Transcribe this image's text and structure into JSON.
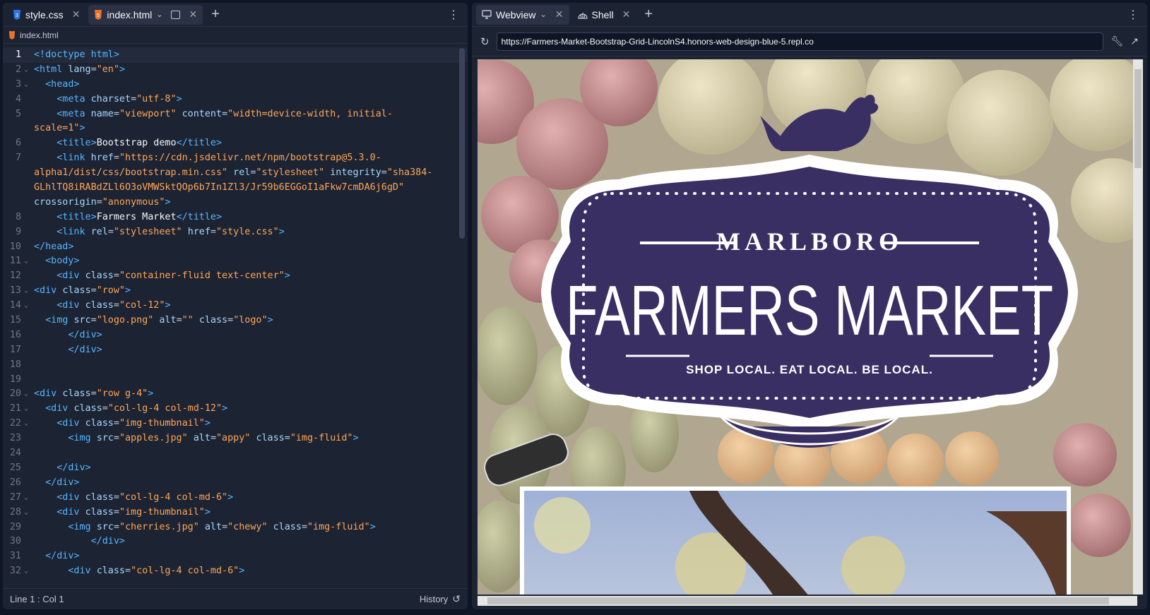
{
  "editor_tabs": [
    {
      "label": "style.css",
      "icon": "css-file-icon"
    },
    {
      "label": "index.html",
      "icon": "html-file-icon"
    }
  ],
  "breadcrumb": "index.html",
  "code_lines": [
    {
      "n": "1",
      "fold": "",
      "html": "<span class='t'>&lt;!doctype html&gt;</span>"
    },
    {
      "n": "2",
      "fold": "⌄",
      "html": "<span class='t'>&lt;html</span> <span class='a'>lang</span>=<span class='s'>\"en\"</span><span class='t'>&gt;</span>"
    },
    {
      "n": "3",
      "fold": "⌄",
      "html": "  <span class='t'>&lt;head&gt;</span>"
    },
    {
      "n": "4",
      "fold": "",
      "html": "    <span class='t'>&lt;meta</span> <span class='a'>charset</span>=<span class='s'>\"utf-8\"</span><span class='t'>&gt;</span>"
    },
    {
      "n": "5",
      "fold": "",
      "html": "    <span class='t'>&lt;meta</span> <span class='a'>name</span>=<span class='s'>\"viewport\"</span> <span class='a'>content</span>=<span class='s'>\"width=device-width, initial-</span>"
    },
    {
      "n": "",
      "fold": "",
      "html": "<span class='s'>scale=1\"</span><span class='t'>&gt;</span>"
    },
    {
      "n": "6",
      "fold": "",
      "html": "    <span class='t'>&lt;title&gt;</span><span class='w'>Bootstrap demo</span><span class='t'>&lt;/title&gt;</span>"
    },
    {
      "n": "7",
      "fold": "",
      "html": "    <span class='t'>&lt;link</span> <span class='a'>href</span>=<span class='s'>\"https://cdn.jsdelivr.net/npm/bootstrap@5.3.0-</span>"
    },
    {
      "n": "",
      "fold": "",
      "html": "<span class='s'>alpha1/dist/css/bootstrap.min.css\"</span> <span class='a'>rel</span>=<span class='s'>\"stylesheet\"</span> <span class='a'>integrity</span>=<span class='s'>\"sha384-</span>"
    },
    {
      "n": "",
      "fold": "",
      "html": "<span class='s'>GLhlTQ8iRABdZLl6O3oVMWSktQOp6b7In1Zl3/Jr59b6EGGoI1aFkw7cmDA6j6gD\"</span>"
    },
    {
      "n": "",
      "fold": "",
      "html": "<span class='a'>crossorigin</span>=<span class='s'>\"anonymous\"</span><span class='t'>&gt;</span>"
    },
    {
      "n": "8",
      "fold": "",
      "html": "    <span class='t'>&lt;title&gt;</span><span class='w'>Farmers Market</span><span class='t'>&lt;/title&gt;</span>"
    },
    {
      "n": "9",
      "fold": "",
      "html": "    <span class='t'>&lt;link</span> <span class='a'>rel</span>=<span class='s'>\"stylesheet\"</span> <span class='a'>href</span>=<span class='s'>\"style.css\"</span><span class='t'>&gt;</span>"
    },
    {
      "n": "10",
      "fold": "",
      "html": "<span class='t'>&lt;/head&gt;</span>"
    },
    {
      "n": "11",
      "fold": "⌄",
      "html": "  <span class='t'>&lt;body&gt;</span>"
    },
    {
      "n": "12",
      "fold": "",
      "html": "    <span class='t'>&lt;div</span> <span class='a'>class</span>=<span class='s'>\"container-fluid text-center\"</span><span class='t'>&gt;</span>"
    },
    {
      "n": "13",
      "fold": "⌄",
      "html": "<span class='t'>&lt;div</span> <span class='a'>class</span>=<span class='s'>\"row\"</span><span class='t'>&gt;</span>"
    },
    {
      "n": "14",
      "fold": "⌄",
      "html": "    <span class='t'>&lt;div</span> <span class='a'>class</span>=<span class='s'>\"col-12\"</span><span class='t'>&gt;</span>"
    },
    {
      "n": "15",
      "fold": "",
      "html": "  <span class='t'>&lt;img</span> <span class='a'>src</span>=<span class='s'>\"logo.png\"</span> <span class='a'>alt</span>=<span class='s'>\"\"</span> <span class='a'>class</span>=<span class='s'>\"logo\"</span><span class='t'>&gt;</span>"
    },
    {
      "n": "16",
      "fold": "",
      "html": "      <span class='t'>&lt;/div&gt;</span>"
    },
    {
      "n": "17",
      "fold": "",
      "html": "      <span class='t'>&lt;/div&gt;</span>"
    },
    {
      "n": "18",
      "fold": "",
      "html": ""
    },
    {
      "n": "19",
      "fold": "",
      "html": ""
    },
    {
      "n": "20",
      "fold": "⌄",
      "html": "<span class='t'>&lt;div</span> <span class='a'>class</span>=<span class='s'>\"row g-4\"</span><span class='t'>&gt;</span>"
    },
    {
      "n": "21",
      "fold": "⌄",
      "html": "  <span class='t'>&lt;div</span> <span class='a'>class</span>=<span class='s'>\"col-lg-4 col-md-12\"</span><span class='t'>&gt;</span>"
    },
    {
      "n": "22",
      "fold": "⌄",
      "html": "    <span class='t'>&lt;div</span> <span class='a'>class</span>=<span class='s'>\"img-thumbnail\"</span><span class='t'>&gt;</span>"
    },
    {
      "n": "23",
      "fold": "",
      "html": "      <span class='t'>&lt;img</span> <span class='a'>src</span>=<span class='s'>\"apples.jpg\"</span> <span class='a'>alt</span>=<span class='s'>\"appy\"</span> <span class='a'>class</span>=<span class='s'>\"img-fluid\"</span><span class='t'>&gt;</span>"
    },
    {
      "n": "24",
      "fold": "",
      "html": ""
    },
    {
      "n": "25",
      "fold": "",
      "html": "    <span class='t'>&lt;/div&gt;</span>"
    },
    {
      "n": "26",
      "fold": "",
      "html": "  <span class='t'>&lt;/div&gt;</span>"
    },
    {
      "n": "27",
      "fold": "⌄",
      "html": "    <span class='t'>&lt;div</span> <span class='a'>class</span>=<span class='s'>\"col-lg-4 col-md-6\"</span><span class='t'>&gt;</span>"
    },
    {
      "n": "28",
      "fold": "⌄",
      "html": "    <span class='t'>&lt;div</span> <span class='a'>class</span>=<span class='s'>\"img-thumbnail\"</span><span class='t'>&gt;</span>"
    },
    {
      "n": "29",
      "fold": "",
      "html": "      <span class='t'>&lt;img</span> <span class='a'>src</span>=<span class='s'>\"cherries.jpg\"</span> <span class='a'>alt</span>=<span class='s'>\"chewy\"</span> <span class='a'>class</span>=<span class='s'>\"img-fluid\"</span><span class='t'>&gt;</span>"
    },
    {
      "n": "30",
      "fold": "",
      "html": "          <span class='t'>&lt;/div&gt;</span>"
    },
    {
      "n": "31",
      "fold": "",
      "html": "  <span class='t'>&lt;/div&gt;</span>"
    },
    {
      "n": "32",
      "fold": "⌄",
      "html": "      <span class='t'>&lt;div</span> <span class='a'>class</span>=<span class='s'>\"col-lg-4 col-md-6\"</span><span class='t'>&gt;</span>"
    }
  ],
  "status": {
    "position": "Line 1 : Col 1",
    "history": "History"
  },
  "preview_tabs": [
    {
      "label": "Webview",
      "icon": "monitor-icon"
    },
    {
      "label": "Shell",
      "icon": "shell-icon"
    }
  ],
  "url": "https://Farmers-Market-Bootstrap-Grid-LincolnS4.honors-web-design-blue-5.repl.co",
  "logo": {
    "top": "MARLBORO",
    "main": "FARMERS MARKET",
    "tagline": "SHOP LOCAL. EAT LOCAL. BE LOCAL."
  },
  "colors": {
    "logo_purple": "#3a2f63",
    "accent": "#0079f2"
  }
}
